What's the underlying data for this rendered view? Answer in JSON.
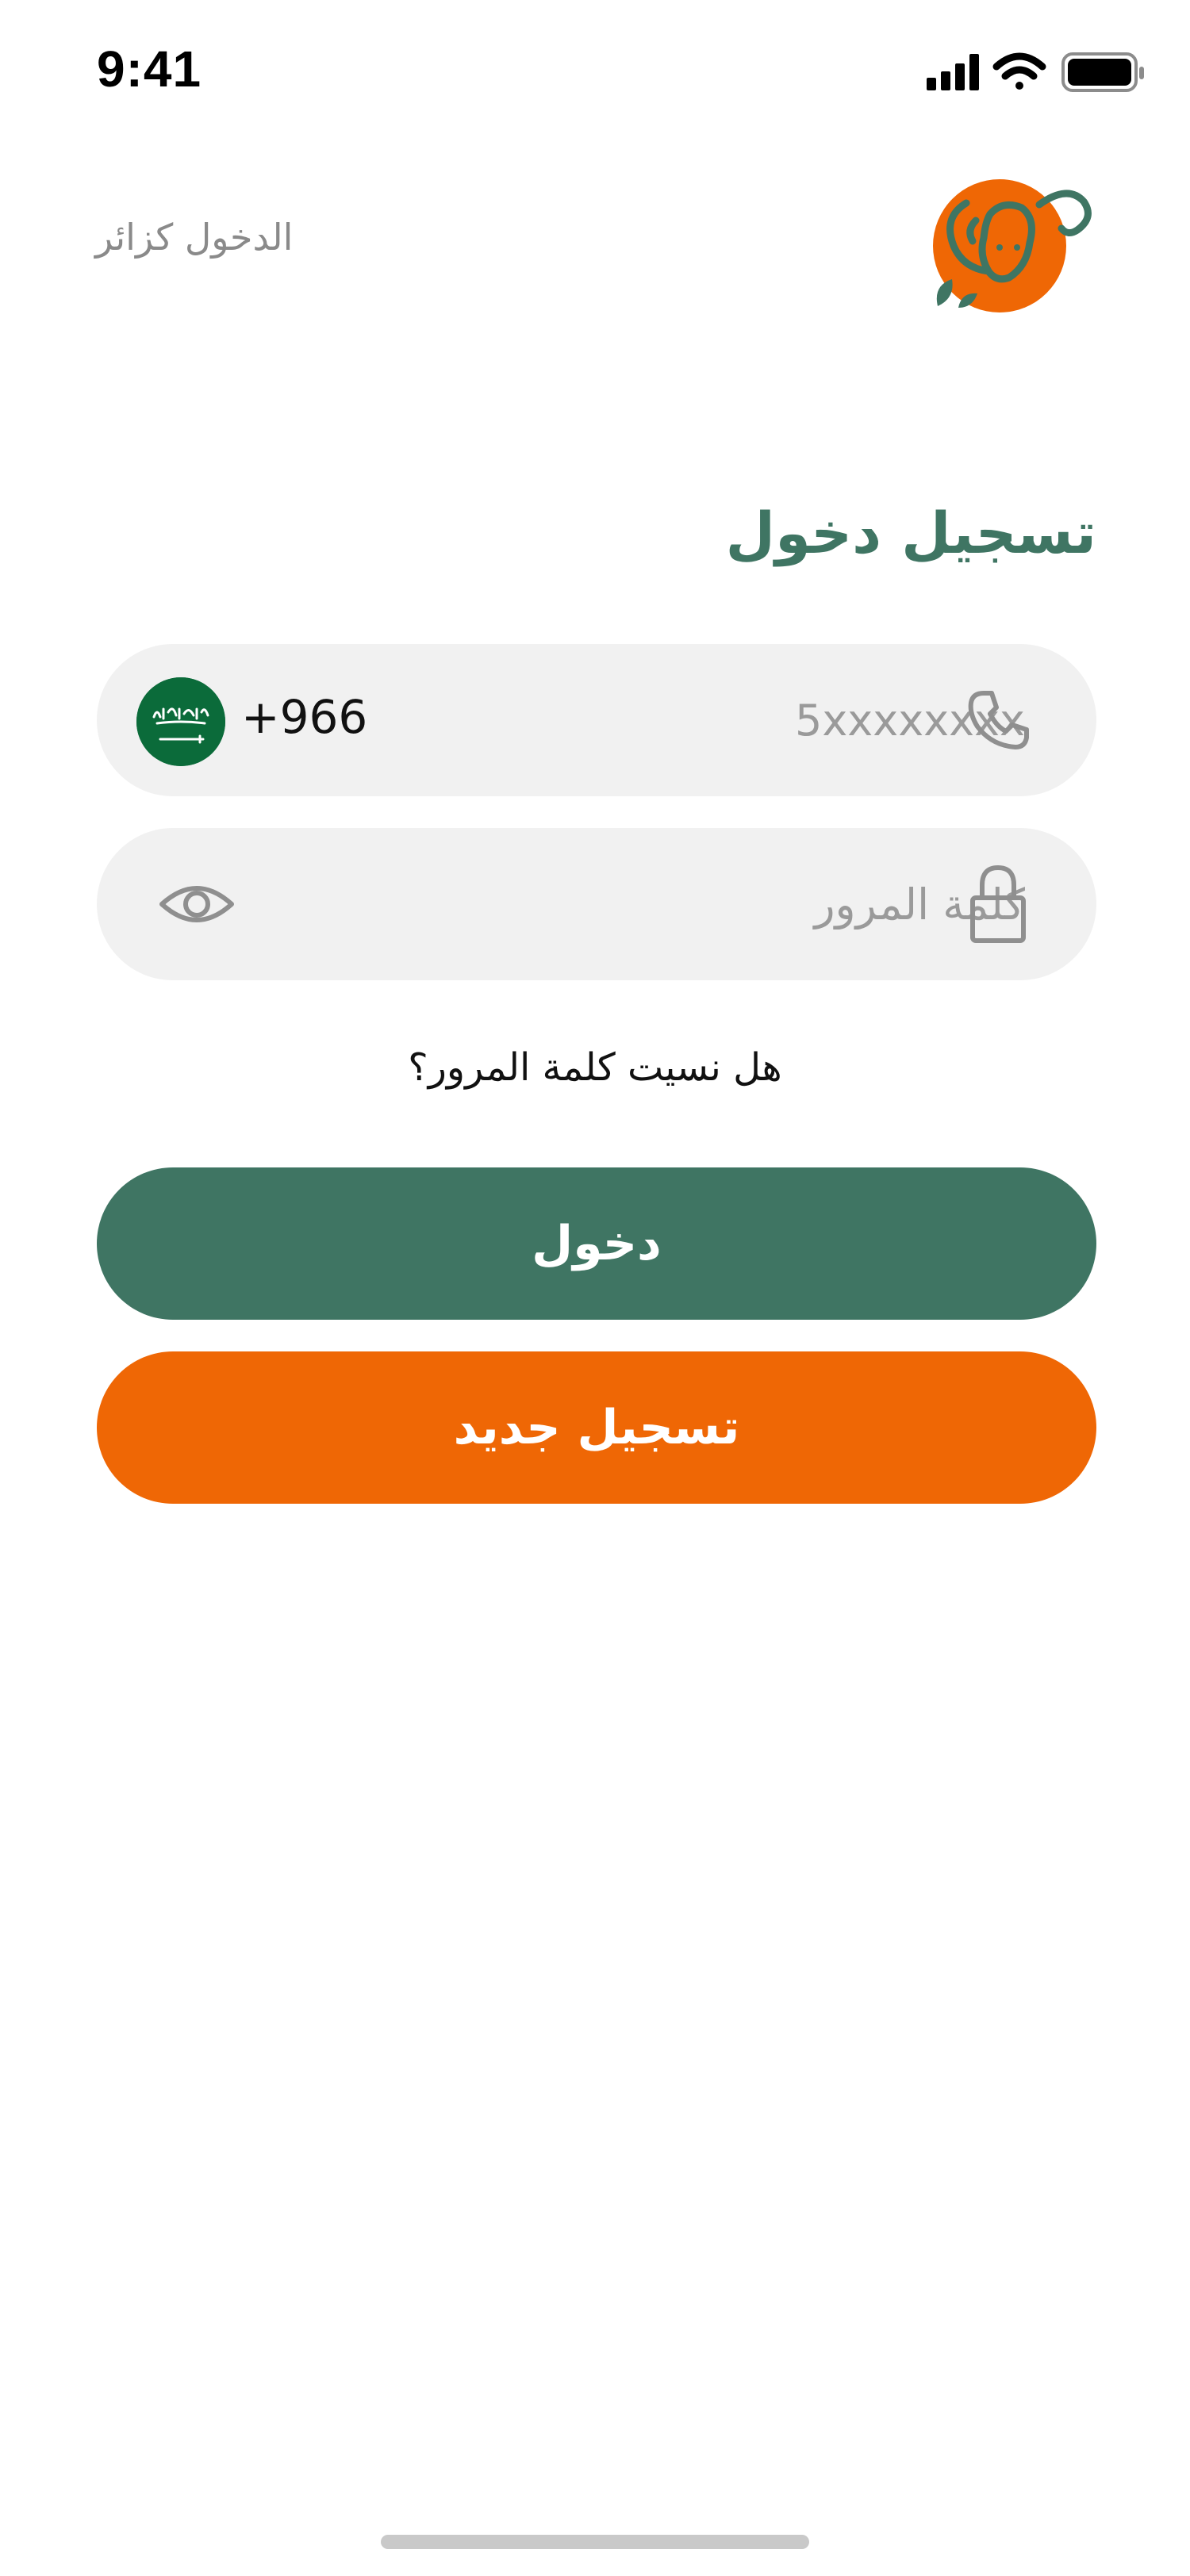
{
  "status_bar": {
    "time": "9:41"
  },
  "header": {
    "guest_login_label": "الدخول كزائر"
  },
  "login": {
    "title": "تسجيل دخول",
    "phone": {
      "country_code": "+966",
      "placeholder": "5xxxxxxxx",
      "value": ""
    },
    "password": {
      "placeholder": "كلمة المرور",
      "value": ""
    },
    "forgot_password_label": "هل نسيت كلمة المرور؟",
    "login_button_label": "دخول",
    "register_button_label": "تسجيل جديد"
  },
  "colors": {
    "primary_green": "#3f7563",
    "accent_orange": "#ef6705",
    "field_background": "#f1f1f1",
    "placeholder_gray": "#9a9a9a"
  },
  "icons": [
    "signal-icon",
    "wifi-icon",
    "battery-icon",
    "sheep-logo",
    "saudi-flag-icon",
    "phone-icon",
    "lock-icon",
    "eye-icon"
  ]
}
